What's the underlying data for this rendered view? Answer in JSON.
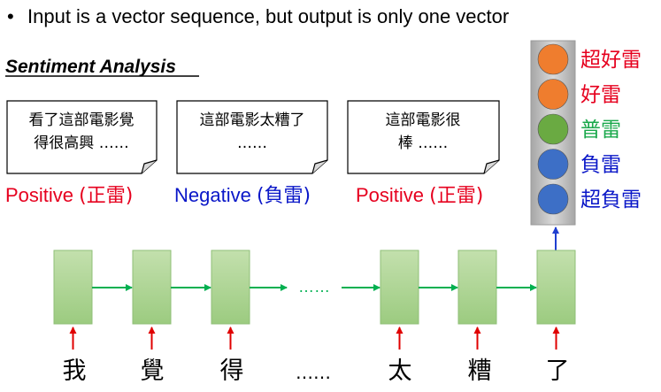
{
  "bullet": {
    "symbol": "•",
    "text": "Input is a vector sequence, but output is only one vector"
  },
  "section_title": "Sentiment Analysis",
  "notes": [
    {
      "lines": [
        "看了這部電影覺",
        "得很高興 ……"
      ]
    },
    {
      "lines": [
        "這部電影太糟了",
        "……"
      ]
    },
    {
      "lines": [
        "這部電影很",
        "棒 ……"
      ]
    }
  ],
  "labels": [
    {
      "word": "Positive",
      "cn": "(正雷)",
      "color": "#e6001e"
    },
    {
      "word": "Negative",
      "cn": "(負雷)",
      "color": "#0a17c8"
    },
    {
      "word": "Positive",
      "cn": "(正雷)",
      "color": "#e6001e"
    }
  ],
  "output_classes": [
    {
      "label": "超好雷",
      "circle_color": "#ef7d2e",
      "text_color": "#e6001e"
    },
    {
      "label": "好雷",
      "circle_color": "#ef7d2e",
      "text_color": "#e6001e"
    },
    {
      "label": "普雷",
      "circle_color": "#6aaa42",
      "text_color": "#1aa84b"
    },
    {
      "label": "負雷",
      "circle_color": "#3d6fc6",
      "text_color": "#0a17c8"
    },
    {
      "label": "超負雷",
      "circle_color": "#3d6fc6",
      "text_color": "#0a17c8"
    }
  ],
  "sequence": {
    "ellipsis": "……",
    "tokens": [
      "我",
      "覺",
      "得",
      "……",
      "太",
      "糟",
      "了"
    ]
  },
  "colors": {
    "block_fill": "#a9d18e",
    "block_stroke": "#8fbf77",
    "recurrent_arrow": "#00b050",
    "input_arrow": "#e00000",
    "output_arrow": "#1f3fd0",
    "panel_fill": "#bfbfbf"
  }
}
